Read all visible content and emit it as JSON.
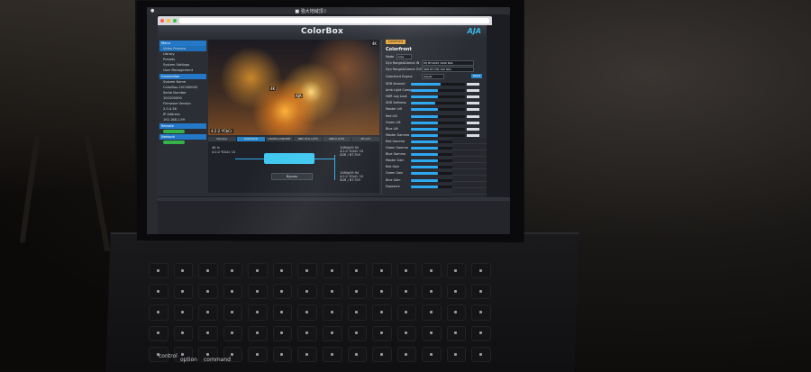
{
  "menubar": {
    "title": "■ 強大地域頂 I"
  },
  "app": {
    "title": "ColorBox",
    "brand": "AJA"
  },
  "nav": {
    "menu_header": "Menu",
    "items": [
      "Video Preview",
      "Library",
      "Presets",
      "System Settings",
      "User Management"
    ],
    "connection_header": "Connection",
    "system_name_label": "System Name",
    "system_name": "ColorBox-10C000000",
    "serial_label": "Serial Number",
    "serial": "10C000000",
    "firmware_label": "Firmware Version",
    "firmware": "2.0.0.36",
    "ip_label": "IP Address",
    "ip": "192.168.1.99",
    "remote_header": "Remote",
    "network_header": "Network"
  },
  "video": {
    "badge": "4K",
    "label": "4K",
    "hud_left": "4:2:2 YCbCr",
    "hud_right": "AJA"
  },
  "pipeline": {
    "tabs": [
      "Pipeline",
      "Colorfront",
      "ORION-CONVERT",
      "BBC HLG LUTS",
      "NBCU LUTS",
      "3D LUT"
    ],
    "input_label": "4K In",
    "input_format": "4:2:2 YCbCr 10",
    "bypass_label": "Bypass",
    "out1": "1080p59.94",
    "out1_format": "4:2:2 YCbCr 10",
    "out1_gamut": "SDR / BT.709",
    "out2": "1080p59.94",
    "out2_format": "4:2:2 YCbCr 10",
    "out2_gamut": "SDR / BT.709"
  },
  "panel": {
    "tab": "Colorfront",
    "title": "Colorfront",
    "mode_label": "Mode",
    "mode": "Live",
    "dyn_in_label": "Dyn Range&Gamut IN",
    "dyn_in": "PQ BT.2020 1000 Nits",
    "dyn_out_label": "Dyn Range&Gamut OUT",
    "dyn_out": "SDR BT.709 100 Nits",
    "engine_label": "Colorfront Engine",
    "engine": "Adjust",
    "reset": "Reset",
    "sliders": [
      {
        "label": "SDR Amount",
        "value": 0.55
      },
      {
        "label": "Amb Light Comp",
        "value": 0.5
      },
      {
        "label": "HDR Log Look",
        "value": 0.5
      },
      {
        "label": "SDR Softness",
        "value": 0.45
      },
      {
        "label": "Master Lift",
        "value": 0.5
      },
      {
        "label": "Red Lift",
        "value": 0.5
      },
      {
        "label": "Green Lift",
        "value": 0.5
      },
      {
        "label": "Blue Lift",
        "value": 0.5
      },
      {
        "label": "Master Gamma",
        "value": 0.5
      },
      {
        "label": "Red Gamma",
        "value": 0.5
      },
      {
        "label": "Green Gamma",
        "value": 0.5
      },
      {
        "label": "Blue Gamma",
        "value": 0.5
      },
      {
        "label": "Master Gain",
        "value": 0.5
      },
      {
        "label": "Red Gain",
        "value": 0.5
      },
      {
        "label": "Green Gain",
        "value": 0.5
      },
      {
        "label": "Blue Gain",
        "value": 0.5
      },
      {
        "label": "Exposure",
        "value": 0.5
      }
    ]
  },
  "keyboard": {
    "labels": [
      "control",
      "option",
      "command"
    ]
  }
}
